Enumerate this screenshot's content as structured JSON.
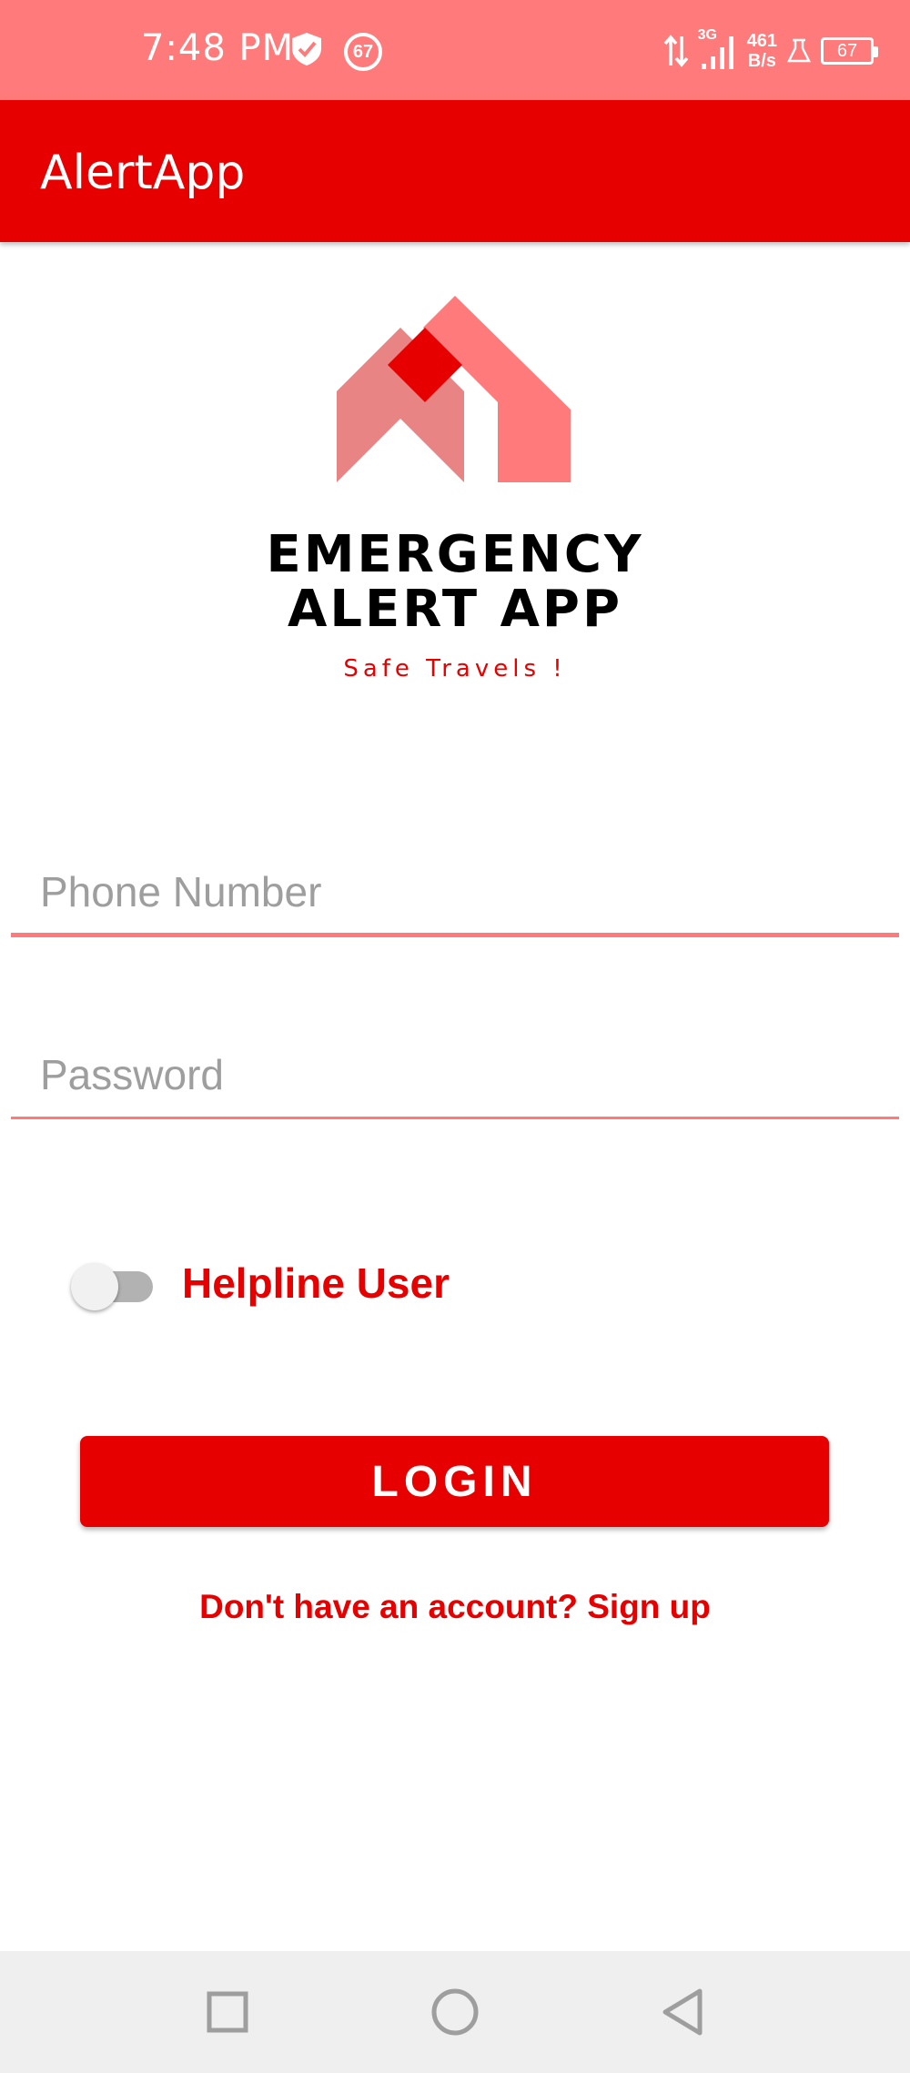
{
  "status_bar": {
    "time": "7:48 PM",
    "notification_badge": "67",
    "network_type": "3G",
    "net_speed_value": "461",
    "net_speed_unit": "B/s",
    "battery_level": "67",
    "icons": [
      "shield-icon",
      "data-transfer-icon",
      "signal-icon",
      "flask-icon",
      "battery-icon"
    ]
  },
  "app_bar": {
    "title": "AlertApp"
  },
  "logo": {
    "line1": "EMERGENCY",
    "line2": "ALERT APP",
    "tagline": "Safe Travels !",
    "colors": {
      "light": "#ff7b7b",
      "dark": "#e60000"
    }
  },
  "form": {
    "phone_placeholder": "Phone Number",
    "phone_value": "",
    "password_placeholder": "Password",
    "password_value": "",
    "helpline_toggle_label": "Helpline User",
    "helpline_toggle_on": false,
    "login_label": "LOGIN",
    "signup_text": "Don't have an account? Sign up"
  },
  "nav_bar": {
    "icons": [
      "recents-square-icon",
      "home-circle-icon",
      "back-triangle-icon"
    ]
  },
  "theme": {
    "primary": "#e60000",
    "status_bar": "#ff7b7b",
    "accent_line": "#ff7b7b"
  }
}
